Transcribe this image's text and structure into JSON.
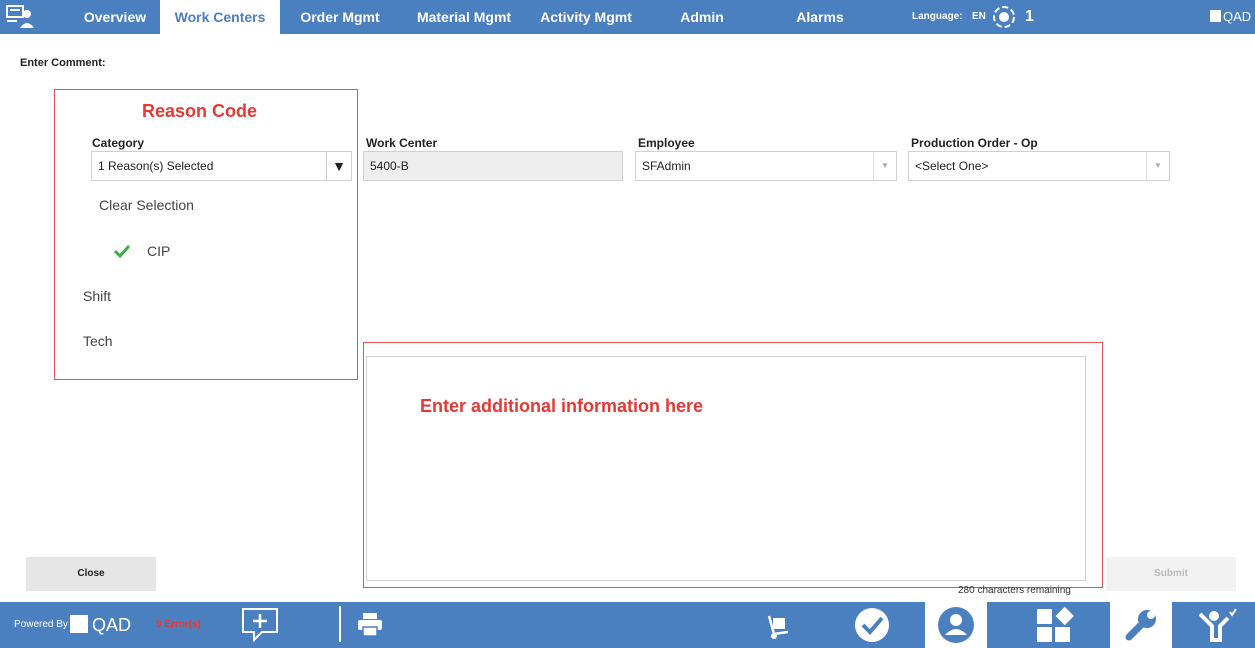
{
  "nav": {
    "tabs": [
      {
        "label": "Overview"
      },
      {
        "label": "Work Centers",
        "active": true
      },
      {
        "label": "Order Mgmt"
      },
      {
        "label": "Material Mgmt"
      },
      {
        "label": "Activity Mgmt"
      },
      {
        "label": "Admin"
      },
      {
        "label": "Alarms"
      }
    ],
    "language_label": "Language:",
    "language_code": "EN",
    "alarm_count": "1",
    "brand": "QAD"
  },
  "page": {
    "title": "Enter Comment:"
  },
  "reason_code": {
    "annotation": "Reason Code",
    "category_label": "Category",
    "category_value": "1 Reason(s) Selected",
    "options": [
      {
        "label": "Clear Selection"
      },
      {
        "label": "CIP",
        "selected": true
      },
      {
        "label": "Shift"
      },
      {
        "label": "Tech"
      }
    ]
  },
  "fields": {
    "work_center_label": "Work Center",
    "work_center_value": "5400-B",
    "employee_label": "Employee",
    "employee_value": "SFAdmin",
    "production_order_label": "Production Order - Op",
    "production_order_value": "<Select One>"
  },
  "comment": {
    "annotation": "Enter additional information here",
    "chars_remaining": "280 characters remaining"
  },
  "buttons": {
    "close": "Close",
    "submit": "Submit"
  },
  "footer": {
    "powered_by": "Powered By",
    "brand": "QAD",
    "errors": "9 Error(s)"
  },
  "colors": {
    "bar": "#4a80c0",
    "annotation": "#e53935",
    "check": "#3cb043"
  }
}
